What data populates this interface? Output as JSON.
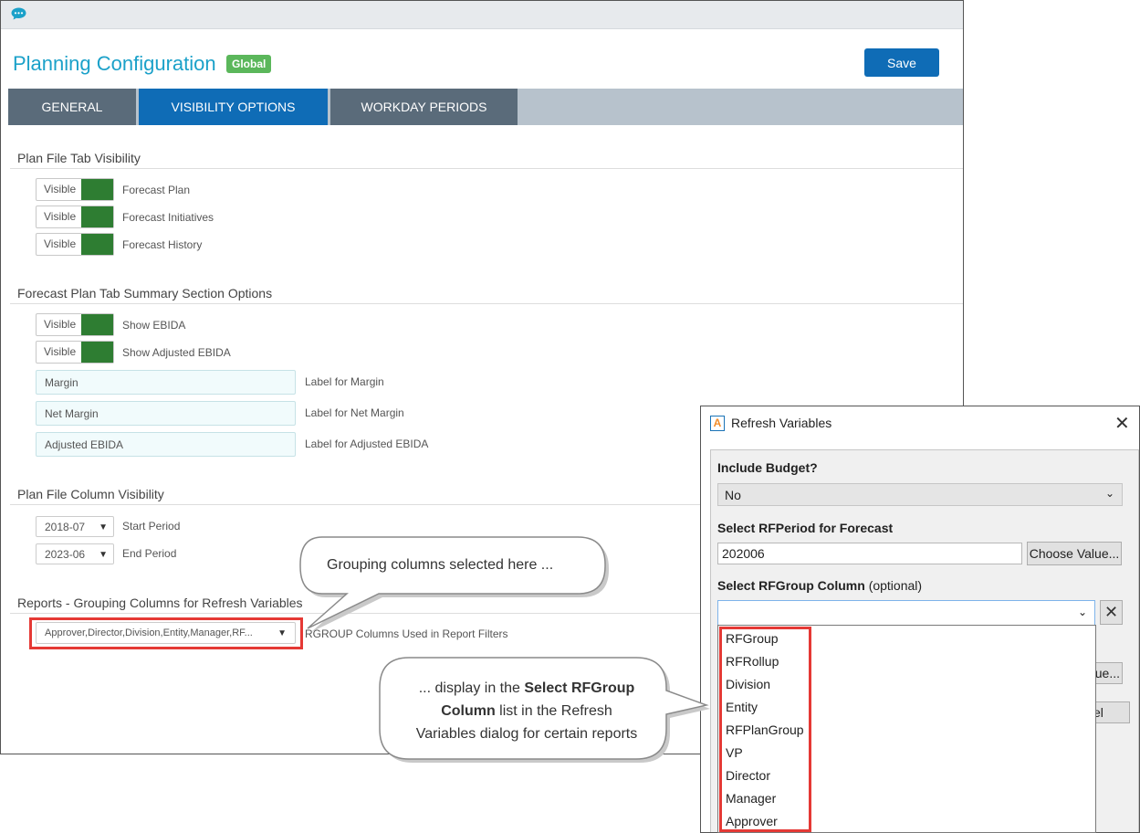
{
  "app": {
    "title": "Planning Configuration",
    "badge": "Global",
    "save_label": "Save"
  },
  "tabs": [
    {
      "label": "GENERAL",
      "active": false
    },
    {
      "label": "VISIBILITY OPTIONS",
      "active": true
    },
    {
      "label": "WORKDAY PERIODS",
      "active": false
    }
  ],
  "sections": {
    "plan_file_tab": {
      "title": "Plan File Tab Visibility",
      "toggles": [
        {
          "state": "Visible",
          "label": "Forecast Plan"
        },
        {
          "state": "Visible",
          "label": "Forecast Initiatives"
        },
        {
          "state": "Visible",
          "label": "Forecast History"
        }
      ]
    },
    "summary": {
      "title": "Forecast Plan Tab Summary Section Options",
      "toggles": [
        {
          "state": "Visible",
          "label": "Show EBIDA"
        },
        {
          "state": "Visible",
          "label": "Show Adjusted EBIDA"
        }
      ],
      "fields": [
        {
          "value": "Margin",
          "label": "Label for Margin"
        },
        {
          "value": "Net Margin",
          "label": "Label for Net Margin"
        },
        {
          "value": "Adjusted EBIDA",
          "label": "Label for Adjusted EBIDA"
        }
      ]
    },
    "column_visibility": {
      "title": "Plan File Column Visibility",
      "start_value": "2018-07",
      "start_label": "Start Period",
      "end_value": "2023-06",
      "end_label": "End Period"
    },
    "reports": {
      "title": "Reports - Grouping Columns for Refresh Variables",
      "value": "Approver,Director,Division,Entity,Manager,RF...",
      "label": "RGROUP Columns Used in Report Filters"
    }
  },
  "callouts": {
    "top": "Grouping columns selected here ...",
    "bottom_line1_pre": "... display in the ",
    "bottom_line1_bold": "Select RFGroup",
    "bottom_line2_bold": "Column",
    "bottom_line2_post": " list in the Refresh",
    "bottom_line3": "Variables dialog for certain reports"
  },
  "dialog": {
    "title": "Refresh Variables",
    "include_budget_label": "Include Budget?",
    "include_budget_value": "No",
    "rfperiod_label": "Select RFPeriod for Forecast",
    "rfperiod_value": "202006",
    "choose_value_label": "Choose Value...",
    "rfgroup_label": "Select RFGroup Column",
    "rfgroup_optional": "(optional)",
    "rfgroup_value": "",
    "partial_value_button": "ue...",
    "partial_cancel_button": "el",
    "options": [
      "RFGroup",
      "RFRollup",
      "Division",
      "Entity",
      "RFPlanGroup",
      "VP",
      "Director",
      "Manager",
      "Approver"
    ]
  }
}
